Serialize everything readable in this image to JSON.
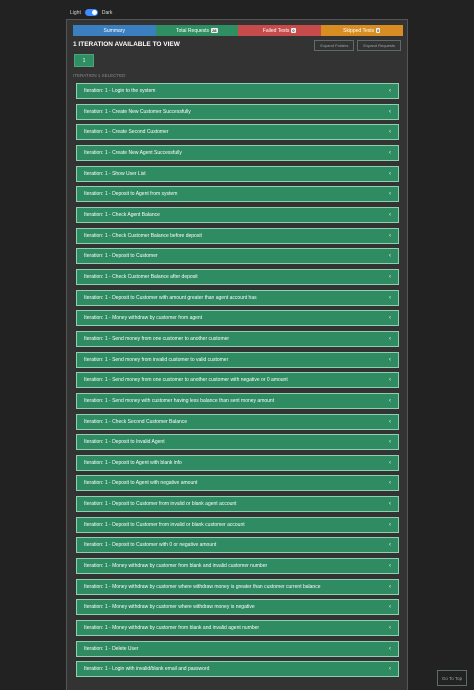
{
  "theme": {
    "light_label": "Light",
    "dark_label": "Dark",
    "dark_enabled": true
  },
  "tabs": [
    {
      "label": "Summary",
      "badge": ""
    },
    {
      "label": "Total Requests",
      "badge": "28"
    },
    {
      "label": "Failed Tests",
      "badge": "0"
    },
    {
      "label": "Skipped Tests",
      "badge": "0"
    }
  ],
  "iteration_header": "1 ITERATION AVAILABLE TO VIEW",
  "expand_buttons": {
    "expand_folders": "Expand Folders",
    "expand_requests": "Expand Requests"
  },
  "iteration_button": "1",
  "selected_note": "ITERATION 1 SELECTED",
  "items": [
    "Iteration: 1 - Login to the system",
    "Iteration: 1 - Create New Customer Successfully",
    "Iteration: 1 - Create Second Customer",
    "Iteration: 1 - Create New Agent Successfully",
    "Iteration: 1 - Show User List",
    "Iteration: 1 - Deposit to Agent from system",
    "Iteration: 1 - Check Agent Balance",
    "Iteration: 1 - Check Customer Balance before deposit",
    "Iteration: 1 - Deposit to Customer",
    "Iteration: 1 - Check Customer Balance after deposit",
    "Iteration: 1 - Deposit to Customer with amount greater than agent account has",
    "Iteration: 1 - Money withdraw by customer from agent",
    "Iteration: 1 - Send money from one customer to another customer",
    "Iteration: 1 - Send money from invalid customer to valid customer",
    "Iteration: 1 - Send money from one customer to another customer with negative or 0 amount",
    "Iteration: 1 - Send money with customer having less balance than sent money amount",
    "Iteration: 1 - Check Second Customer Balance",
    "Iteration: 1 - Deposit to Invalid Agent",
    "Iteration: 1 - Deposit to Agent with blank info",
    "Iteration: 1 - Deposit to Agent with negative amount",
    "Iteration: 1 - Deposit to Customer from invalid or blank agent account",
    "Iteration: 1 - Deposit to Customer from invalid or blank customer account",
    "Iteration: 1 - Deposit to Customer with 0 or negative amount",
    "Iteration: 1 - Money withdraw by customer from blank and invalid customer number",
    "Iteration: 1 - Money withdraw by customer where withdraw money is greater than customer current balance",
    "Iteration: 1 - Money withdraw by customer where withdraw money is negative",
    "Iteration: 1 - Money withdraw by customer from blank and invalid agent number",
    "Iteration: 1 - Delete User",
    "Iteration: 1 - Login with invalid/blank email and password"
  ],
  "go_to_top": "Go To Top"
}
